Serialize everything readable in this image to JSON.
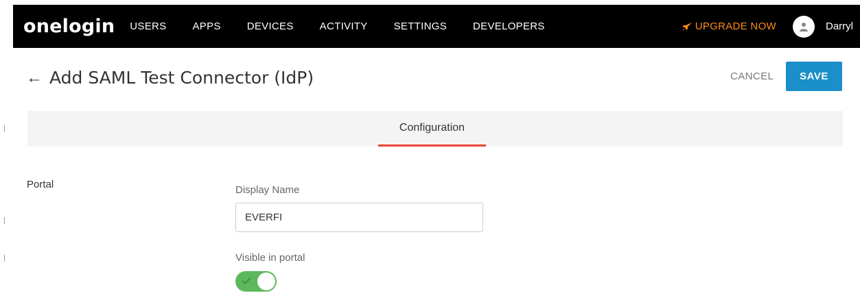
{
  "nav": {
    "logo": "onelogin",
    "items": [
      {
        "label": "USERS"
      },
      {
        "label": "APPS"
      },
      {
        "label": "DEVICES"
      },
      {
        "label": "ACTIVITY"
      },
      {
        "label": "SETTINGS"
      },
      {
        "label": "DEVELOPERS"
      }
    ],
    "upgrade_label": "UPGRADE NOW",
    "username": "Darryl"
  },
  "header": {
    "title": "Add SAML Test Connector (IdP)",
    "cancel_label": "CANCEL",
    "save_label": "SAVE"
  },
  "tabs": [
    {
      "label": "Configuration",
      "active": true
    }
  ],
  "portal": {
    "section_label": "Portal",
    "display_name_label": "Display Name",
    "display_name_value": "EVERFI",
    "visible_label": "Visible in portal",
    "visible_in_portal": true
  },
  "colors": {
    "nav_bg": "#000000",
    "upgrade": "#ff8c1a",
    "save_button": "#1a8fc9",
    "tab_underline": "#e8453c",
    "toggle_on": "#5cb85c"
  },
  "icons": {
    "back": "arrow-left-icon",
    "upgrade": "rocket-icon",
    "avatar": "user-icon",
    "toggle": "check-icon"
  }
}
